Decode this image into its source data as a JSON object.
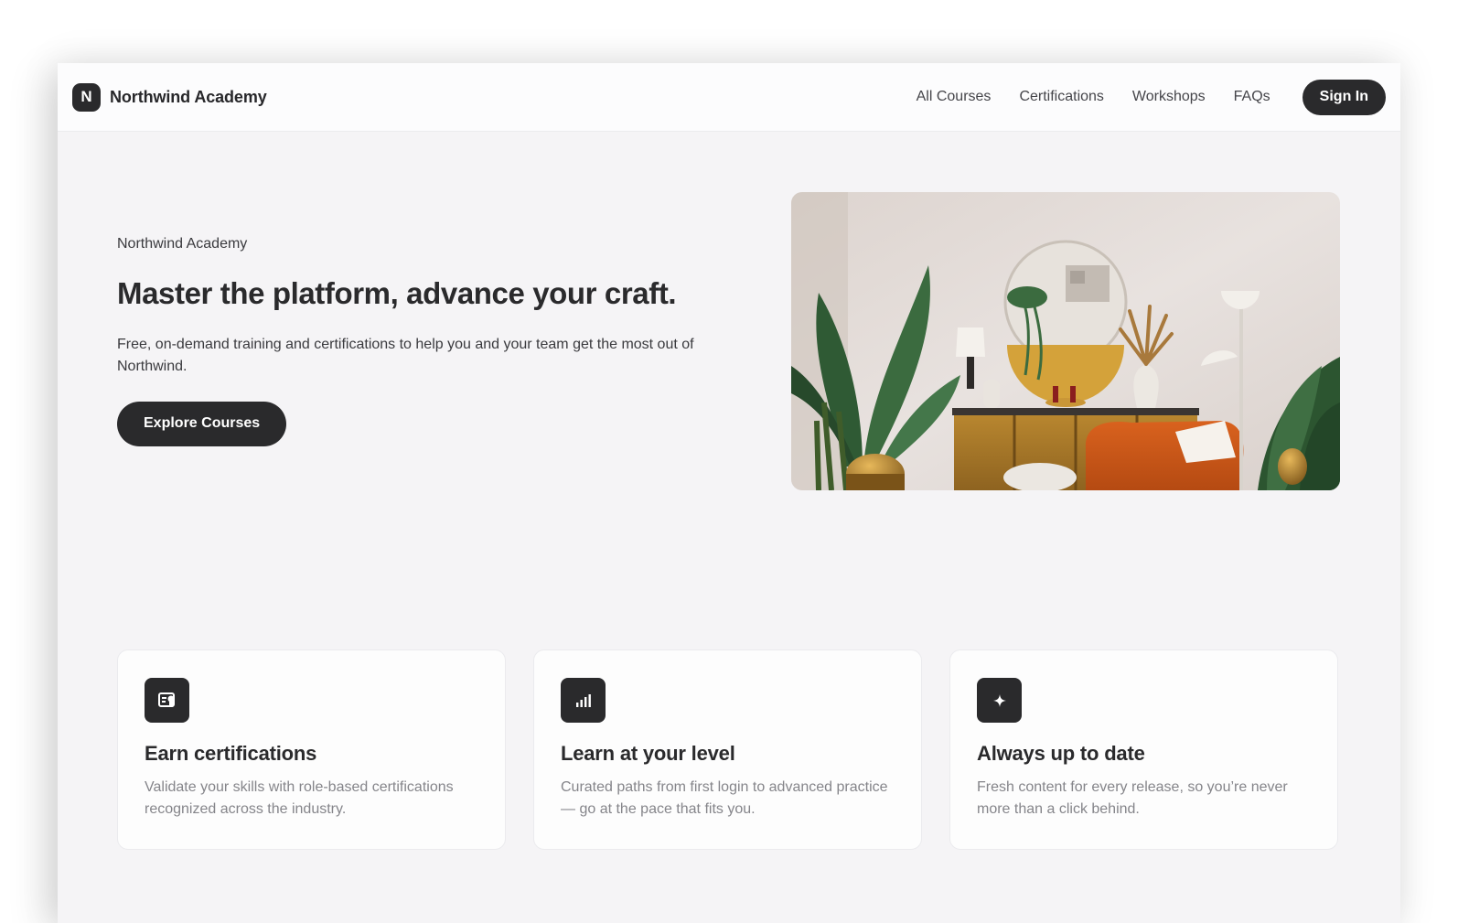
{
  "header": {
    "brand_initial": "N",
    "brand_name": "Northwind Academy",
    "nav": [
      "All Courses",
      "Certifications",
      "Workshops",
      "FAQs"
    ],
    "signin_label": "Sign In"
  },
  "hero": {
    "eyebrow": "Northwind Academy",
    "title": "Master the platform, advance your craft.",
    "subtitle": "Free, on-demand training and certifications to help you and your team get the most out of Northwind.",
    "cta_label": "Explore Courses",
    "image_icon": "living-room-photo"
  },
  "features": [
    {
      "icon": "certificate-icon",
      "title": "Earn certifications",
      "body": "Validate your skills with role-based certifications recognized across the industry."
    },
    {
      "icon": "signal-bars-icon",
      "title": "Learn at your level",
      "body": "Curated paths from first login to advanced practice — go at the pace that fits you."
    },
    {
      "icon": "sparkle-icon",
      "title": "Always up to date",
      "body": "Fresh content for every release, so you’re never more than a click behind."
    }
  ],
  "colors": {
    "primary": "#2a2a2c",
    "page_background": "#f5f4f6",
    "card_background": "#fdfdfd",
    "muted_text": "#85858a"
  }
}
